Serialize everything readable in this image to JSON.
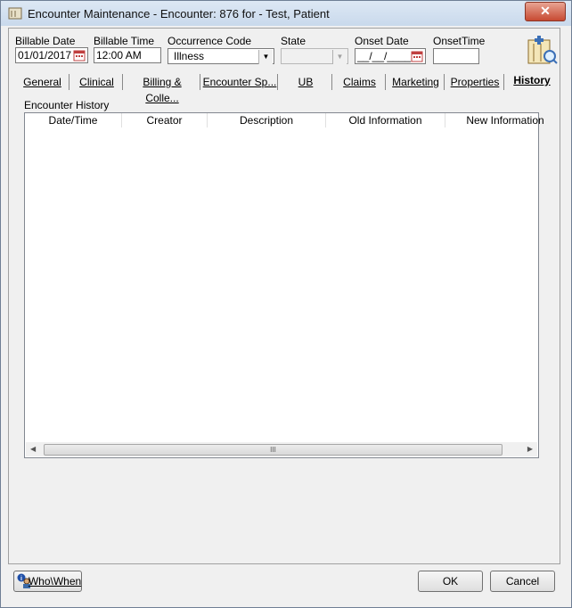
{
  "window": {
    "title": "Encounter Maintenance - Encounter: 876 for - Test, Patient",
    "close_label": "✕"
  },
  "fields": {
    "billable_date_label": "Billable Date",
    "billable_date_value": "01/01/2017",
    "billable_time_label": "Billable Time",
    "billable_time_value": "12:00 AM",
    "occurrence_code_label": "Occurrence Code",
    "occurrence_code_value": "Illness",
    "state_label": "State",
    "state_value": "",
    "onset_date_label": "Onset Date",
    "onset_date_value": "__/__/____",
    "onset_time_label": "OnsetTime",
    "onset_time_value": ""
  },
  "tabs": [
    {
      "label": "General"
    },
    {
      "label": "Clinical"
    },
    {
      "label": "Billing & Colle..."
    },
    {
      "label": "Encounter  Sp..."
    },
    {
      "label": "UB"
    },
    {
      "label": "Claims"
    },
    {
      "label": "Marketing"
    },
    {
      "label": "Properties"
    },
    {
      "label": "History"
    }
  ],
  "history": {
    "section_label": "Encounter History",
    "columns": [
      "Date/Time",
      "Creator",
      "Description",
      "Old Information",
      "New Information"
    ],
    "rows": [],
    "scroll_grip": "III"
  },
  "footer": {
    "whowhen_label": "Who\\When",
    "ok_label": "OK",
    "cancel_label": "Cancel"
  }
}
